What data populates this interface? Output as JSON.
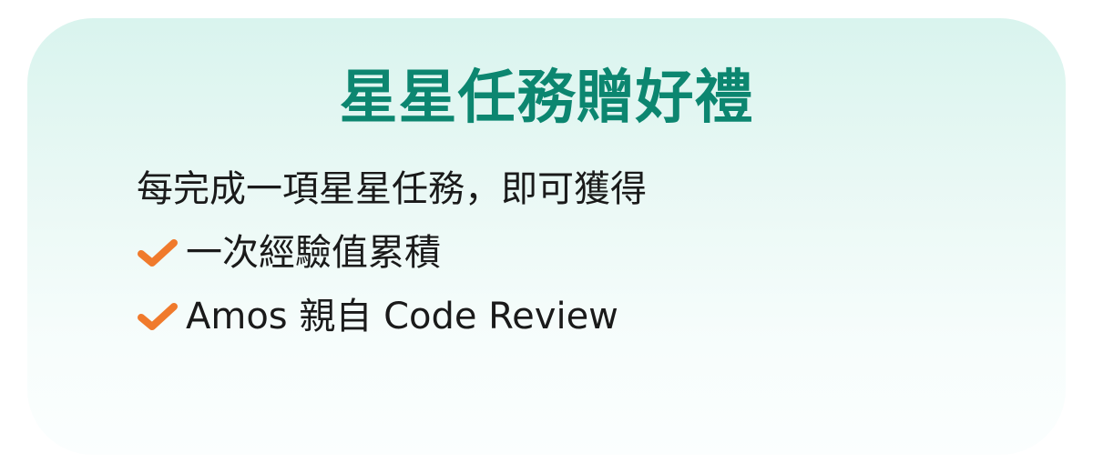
{
  "card": {
    "title": "星星任務贈好禮",
    "intro": "每完成一項星星任務，即可獲得",
    "benefits": [
      {
        "icon": "check-icon",
        "text": "一次經驗值累積"
      },
      {
        "icon": "check-icon",
        "text": "Amos 親自 Code Review"
      }
    ]
  },
  "colors": {
    "title": "#0c8670",
    "check": "#f07a2c",
    "text": "#1a1a1a",
    "card_top": "#d9f4ee",
    "card_bottom": "#fbfefe"
  }
}
